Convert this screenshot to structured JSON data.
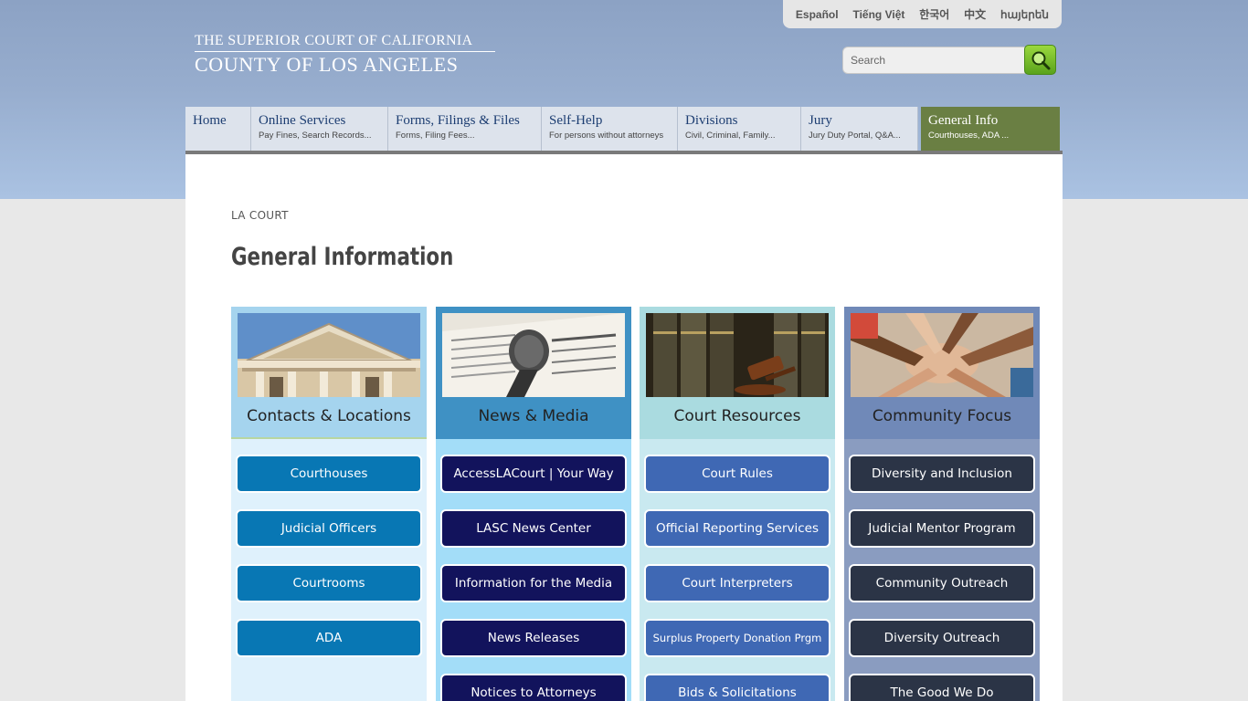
{
  "languages": [
    "Español",
    "Tiếng Việt",
    "한국어",
    "中文",
    "հայերեն"
  ],
  "logo": {
    "line1": "THE SUPERIOR COURT OF CALIFORNIA",
    "line2": "COUNTY OF LOS ANGELES"
  },
  "search": {
    "placeholder": "Search"
  },
  "nav": [
    {
      "title": "Home",
      "sub": ""
    },
    {
      "title": "Online Services",
      "sub": "Pay Fines, Search Records..."
    },
    {
      "title": "Forms, Filings & Files",
      "sub": "Forms, Filing Fees..."
    },
    {
      "title": "Self-Help",
      "sub": "For persons without attorneys"
    },
    {
      "title": "Divisions",
      "sub": "Civil, Criminal, Family..."
    },
    {
      "title": "Jury",
      "sub": "Jury Duty Portal, Q&A..."
    },
    {
      "title": "General Info",
      "sub": "Courthouses, ADA ..."
    }
  ],
  "breadcrumb": "LA COURT",
  "page_title": "General Information",
  "columns": [
    {
      "title": "Contacts & Locations",
      "buttons": [
        "Courthouses",
        "Judicial Officers",
        "Courtrooms",
        "ADA"
      ]
    },
    {
      "title": "News & Media",
      "buttons": [
        "AccessLACourt | Your Way",
        "LASC News Center",
        "Information for the Media",
        "News Releases",
        "Notices to Attorneys"
      ]
    },
    {
      "title": "Court Resources",
      "buttons": [
        "Court Rules",
        "Official Reporting Services",
        "Court Interpreters",
        "Surplus Property Donation Prgm",
        "Bids & Solicitations"
      ]
    },
    {
      "title": "Community Focus",
      "buttons": [
        "Diversity and Inclusion",
        "Judicial Mentor Program",
        "Community Outreach",
        "Diversity Outreach",
        "The Good We Do"
      ]
    }
  ],
  "colors": {
    "contacts_bg": "#dff1fc",
    "contacts_head": "#a5d4ee",
    "contacts_btn": "#0877b4",
    "news_bg": "#a3ddf8",
    "news_head": "#3f91c4",
    "news_btn": "#12135c",
    "resources_bg": "#c9e9f0",
    "resources_head": "#aadbe0",
    "resources_btn": "#3f68b4",
    "community_bg": "#8a9cc0",
    "community_head": "#7089b8",
    "community_btn": "#2b3446",
    "nav_active": "#6a7f43"
  },
  "icons": {
    "search_button": "magnifier-icon"
  }
}
